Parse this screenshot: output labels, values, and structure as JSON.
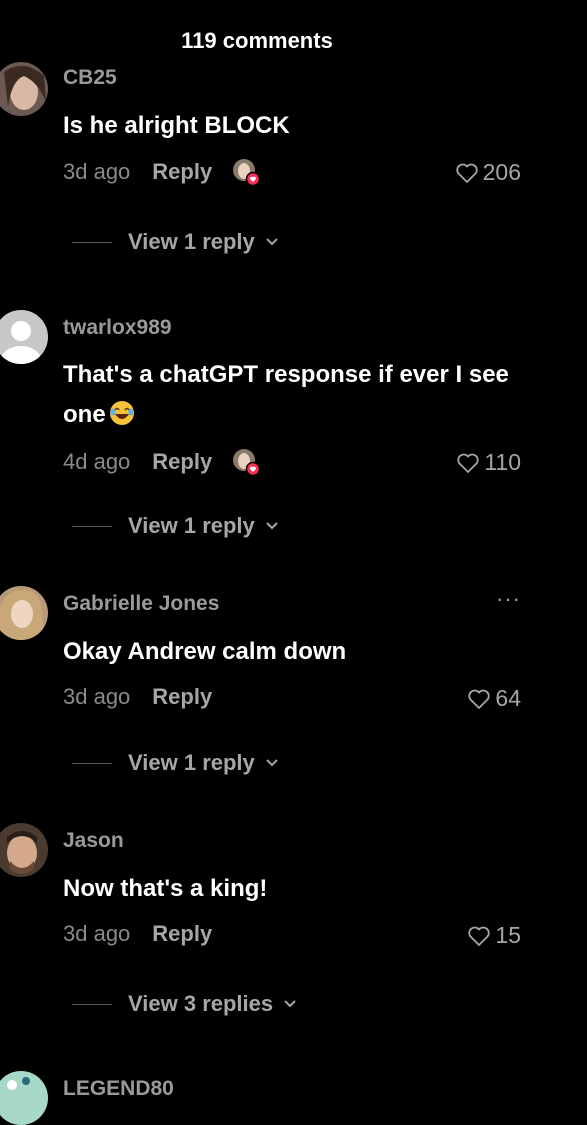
{
  "header": {
    "title": "119 comments"
  },
  "comments": [
    {
      "username": "CB25",
      "text": "Is he alright BLOCK",
      "time": "3d ago",
      "reply_label": "Reply",
      "likes": "206",
      "view_replies": "View 1 reply"
    },
    {
      "username": "twarlox989",
      "text": "That's a chatGPT response if ever I see one",
      "time": "4d ago",
      "reply_label": "Reply",
      "likes": "110",
      "view_replies": "View 1 reply"
    },
    {
      "username": "Gabrielle Jones",
      "text": "Okay Andrew calm down",
      "time": "3d ago",
      "reply_label": "Reply",
      "likes": "64",
      "view_replies": "View 1 reply",
      "more_label": "···"
    },
    {
      "username": "Jason",
      "text": "Now that's a king!",
      "time": "3d ago",
      "reply_label": "Reply",
      "likes": "15",
      "view_replies": "View 3 replies"
    },
    {
      "username": "LEGEND80"
    }
  ],
  "icons": {
    "heart": "heart-icon",
    "chevron": "chevron-down-icon",
    "emoji": "laughing-emoji-icon",
    "creator_like": "creator-liked-icon"
  },
  "colors": {
    "background": "#000000",
    "muted_text": "#a6a6a6",
    "creator_badge": "#fe2c55"
  }
}
